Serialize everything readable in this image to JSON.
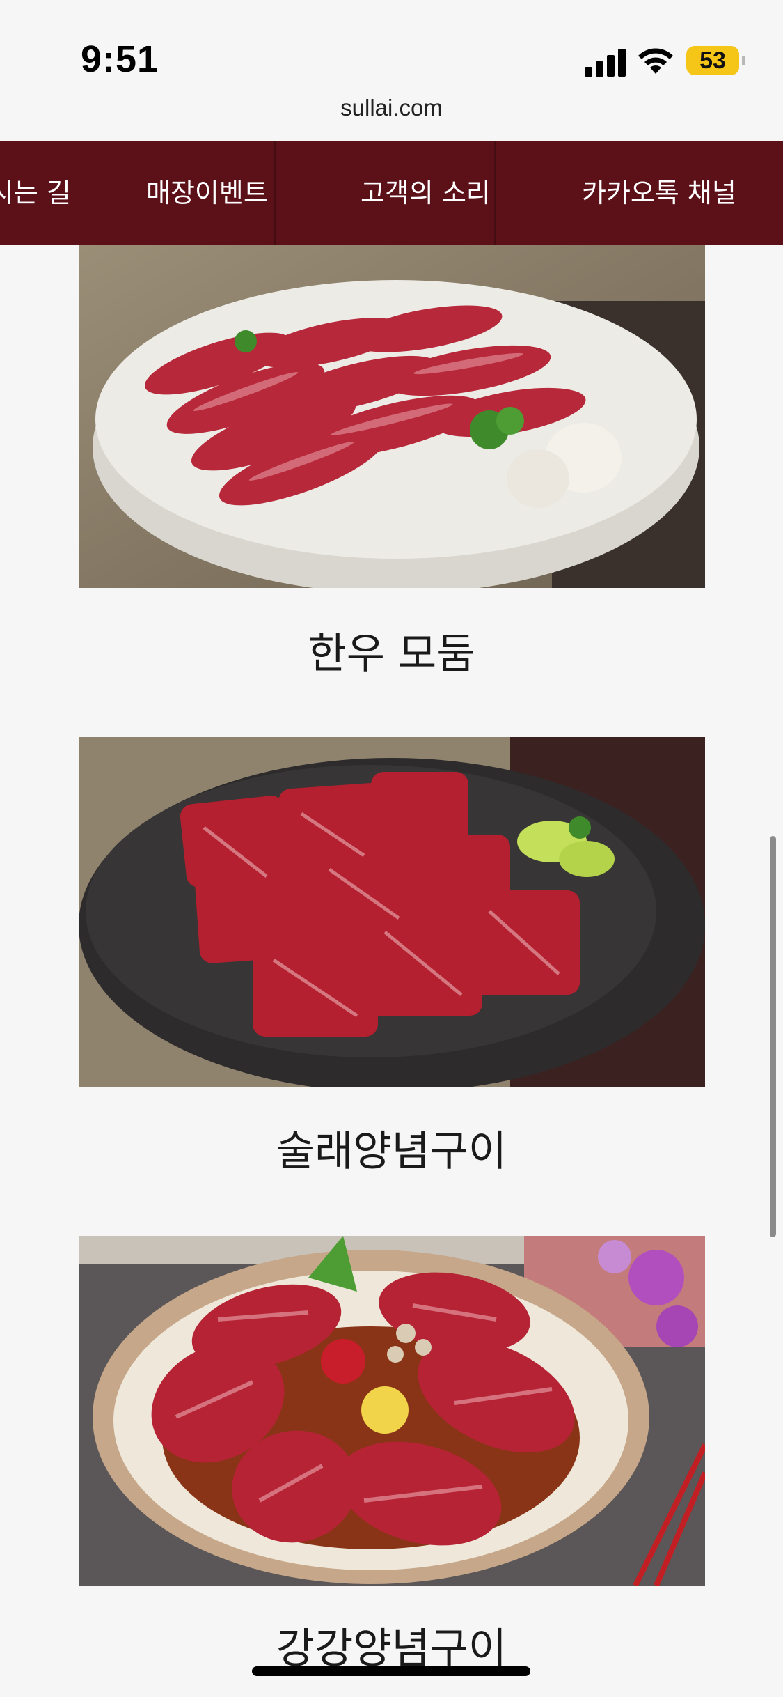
{
  "status_bar": {
    "time": "9:51",
    "battery": "53"
  },
  "browser": {
    "url": "sullai.com"
  },
  "nav": {
    "items": [
      "찾아오시는 길",
      "매장이벤트",
      "고객의 소리",
      "카카오톡 채널"
    ]
  },
  "products": [
    {
      "title": "한우 모둠",
      "image": "marbled-beef-slices-on-white-plate"
    },
    {
      "title": "술래양념구이",
      "image": "beef-cubes-on-black-slate"
    },
    {
      "title": "강강양념구이",
      "image": "marinated-beef-on-cream-plate"
    }
  ],
  "colors": {
    "nav_bg": "#5c1119",
    "page_bg": "#f6f6f6",
    "battery": "#f5c518"
  }
}
